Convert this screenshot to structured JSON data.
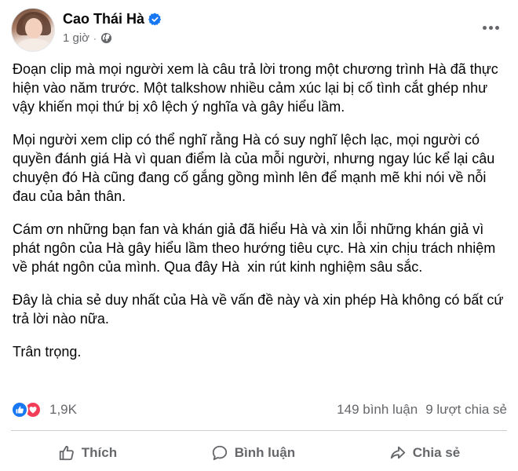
{
  "post": {
    "author_name": "Cao Thái Hà",
    "timestamp": "1 giờ",
    "separator": "·",
    "paragraphs": [
      "Đoạn clip mà mọi người xem là câu trả lời trong một chương trình Hà đã thực hiện vào năm trước. Một talkshow nhiều cảm xúc lại bị cố tình cắt ghép như vậy khiến mọi thứ bị xô lệch ý nghĩa và gây hiểu lầm.",
      "Mọi người xem clip có thể nghĩ rằng Hà có suy nghĩ lệch lạc, mọi người có quyền đánh giá Hà vì quan điểm là của mỗi người, nhưng ngay lúc kể lại câu chuyện đó Hà cũng đang cố gắng gồng mình lên để mạnh mẽ khi nói về nỗi đau của bản thân.",
      "Cám ơn những bạn fan và khán giả đã hiểu Hà và xin lỗi những khán giả vì phát ngôn của Hà gây hiểu lầm theo hướng tiêu cực. Hà xin chịu trách nhiệm về phát ngôn của mình. Qua đây Hà  xin rút kinh nghiệm sâu sắc.",
      "Đây là chia sẻ duy nhất của Hà về vấn đề này và xin phép Hà không có bất cứ trả lời nào nữa.",
      "Trân trọng."
    ]
  },
  "stats": {
    "reaction_count": "1,9K",
    "comments": "149 bình luận",
    "shares": "9 lượt chia sẻ"
  },
  "actions": {
    "like": "Thích",
    "comment": "Bình luận",
    "share": "Chia sẻ"
  },
  "colors": {
    "brand_blue": "#1877f2",
    "love_red": "#f33e58",
    "secondary_text": "#65676b"
  },
  "icons": {
    "verified": "verified-badge-icon",
    "privacy": "globe-icon",
    "more": "more-options-icon",
    "like_reaction": "like-reaction-icon",
    "love_reaction": "love-reaction-icon",
    "like_action": "thumbs-up-icon",
    "comment_action": "comment-bubble-icon",
    "share_action": "share-arrow-icon"
  }
}
